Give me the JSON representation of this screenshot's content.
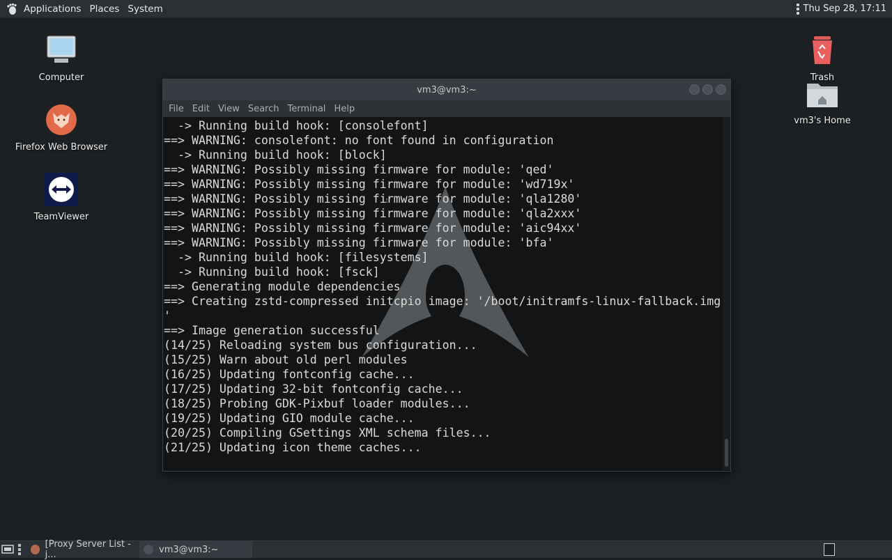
{
  "top_panel": {
    "menus": [
      "Applications",
      "Places",
      "System"
    ],
    "clock": "Thu Sep 28, 17:11"
  },
  "desktop": {
    "icons_left": [
      {
        "label": "Computer",
        "icon": "computer-icon"
      },
      {
        "label": "Firefox Web Browser",
        "icon": "firefox-icon"
      },
      {
        "label": "TeamViewer",
        "icon": "teamviewer-icon"
      }
    ],
    "icons_right": [
      {
        "label": "Trash",
        "icon": "trash-icon"
      },
      {
        "label": "vm3's Home",
        "icon": "home-folder-icon"
      }
    ]
  },
  "terminal": {
    "title": "vm3@vm3:~",
    "menu": [
      "File",
      "Edit",
      "View",
      "Search",
      "Terminal",
      "Help"
    ],
    "lines": [
      "  -> Running build hook: [consolefont]",
      "==> WARNING: consolefont: no font found in configuration",
      "  -> Running build hook: [block]",
      "==> WARNING: Possibly missing firmware for module: 'qed'",
      "==> WARNING: Possibly missing firmware for module: 'wd719x'",
      "==> WARNING: Possibly missing firmware for module: 'qla1280'",
      "==> WARNING: Possibly missing firmware for module: 'qla2xxx'",
      "==> WARNING: Possibly missing firmware for module: 'aic94xx'",
      "==> WARNING: Possibly missing firmware for module: 'bfa'",
      "  -> Running build hook: [filesystems]",
      "  -> Running build hook: [fsck]",
      "==> Generating module dependencies",
      "==> Creating zstd-compressed initcpio image: '/boot/initramfs-linux-fallback.img",
      "'",
      "==> Image generation successful",
      "(14/25) Reloading system bus configuration...",
      "(15/25) Warn about old perl modules",
      "(16/25) Updating fontconfig cache...",
      "(17/25) Updating 32-bit fontconfig cache...",
      "(18/25) Probing GDK-Pixbuf loader modules...",
      "(19/25) Updating GIO module cache...",
      "(20/25) Compiling GSettings XML schema files...",
      "(21/25) Updating icon theme caches..."
    ]
  },
  "bottom_panel": {
    "tasks": [
      {
        "label": "[Proxy Server List - j...",
        "icon": "firefox-icon"
      },
      {
        "label": "vm3@vm3:~",
        "icon": "terminal-icon"
      }
    ]
  }
}
